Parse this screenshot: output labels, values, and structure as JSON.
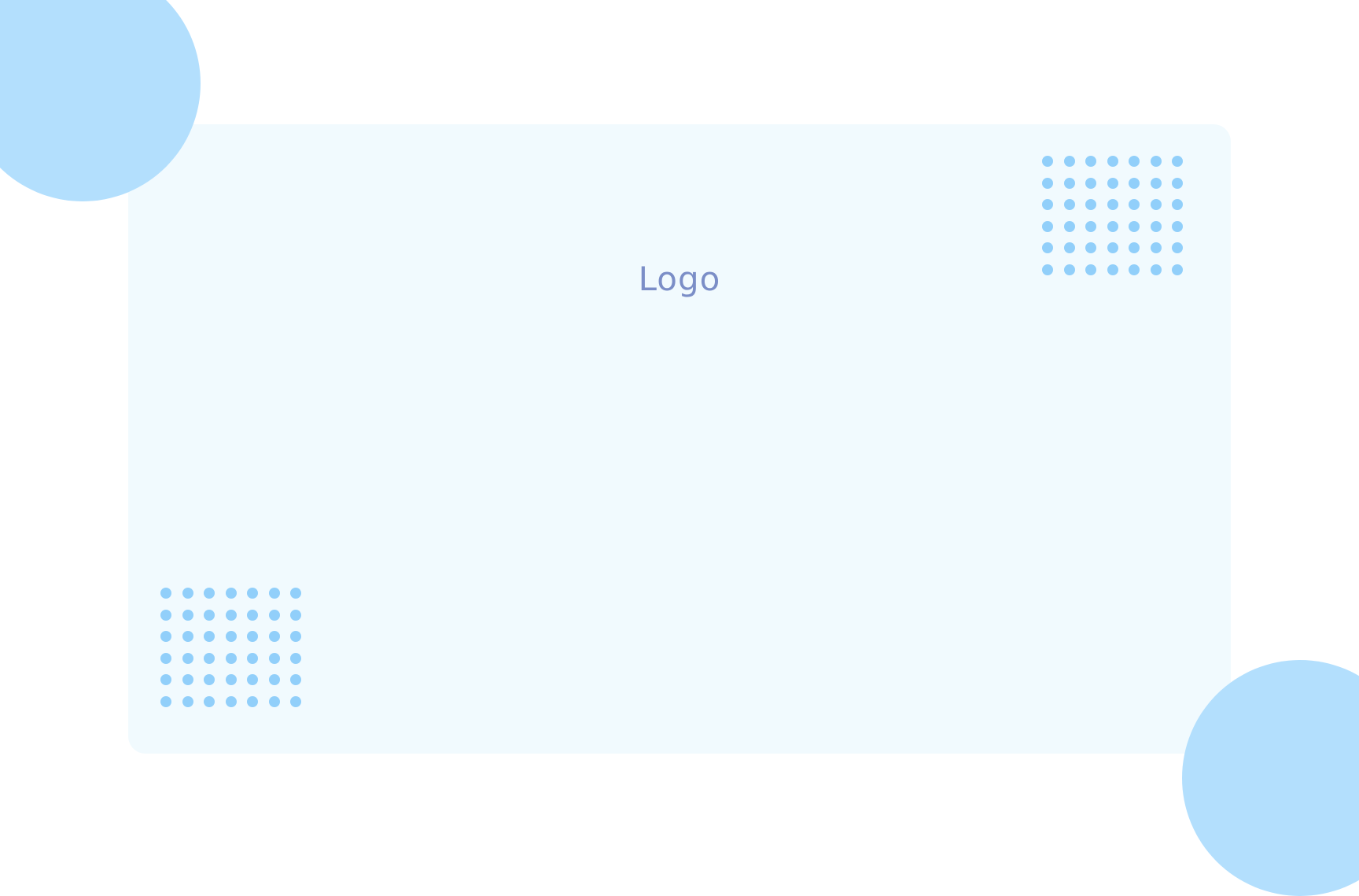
{
  "brand": {
    "logo_text": "Logo"
  },
  "colors": {
    "page_background": "#ffffff",
    "card_background": "#f1fafe",
    "circle": "#b3dffd",
    "dot": "#91cffa",
    "logo_text": "#7b8ec7"
  },
  "decorations": {
    "dot_grid": {
      "columns": 7,
      "rows": 6
    }
  }
}
